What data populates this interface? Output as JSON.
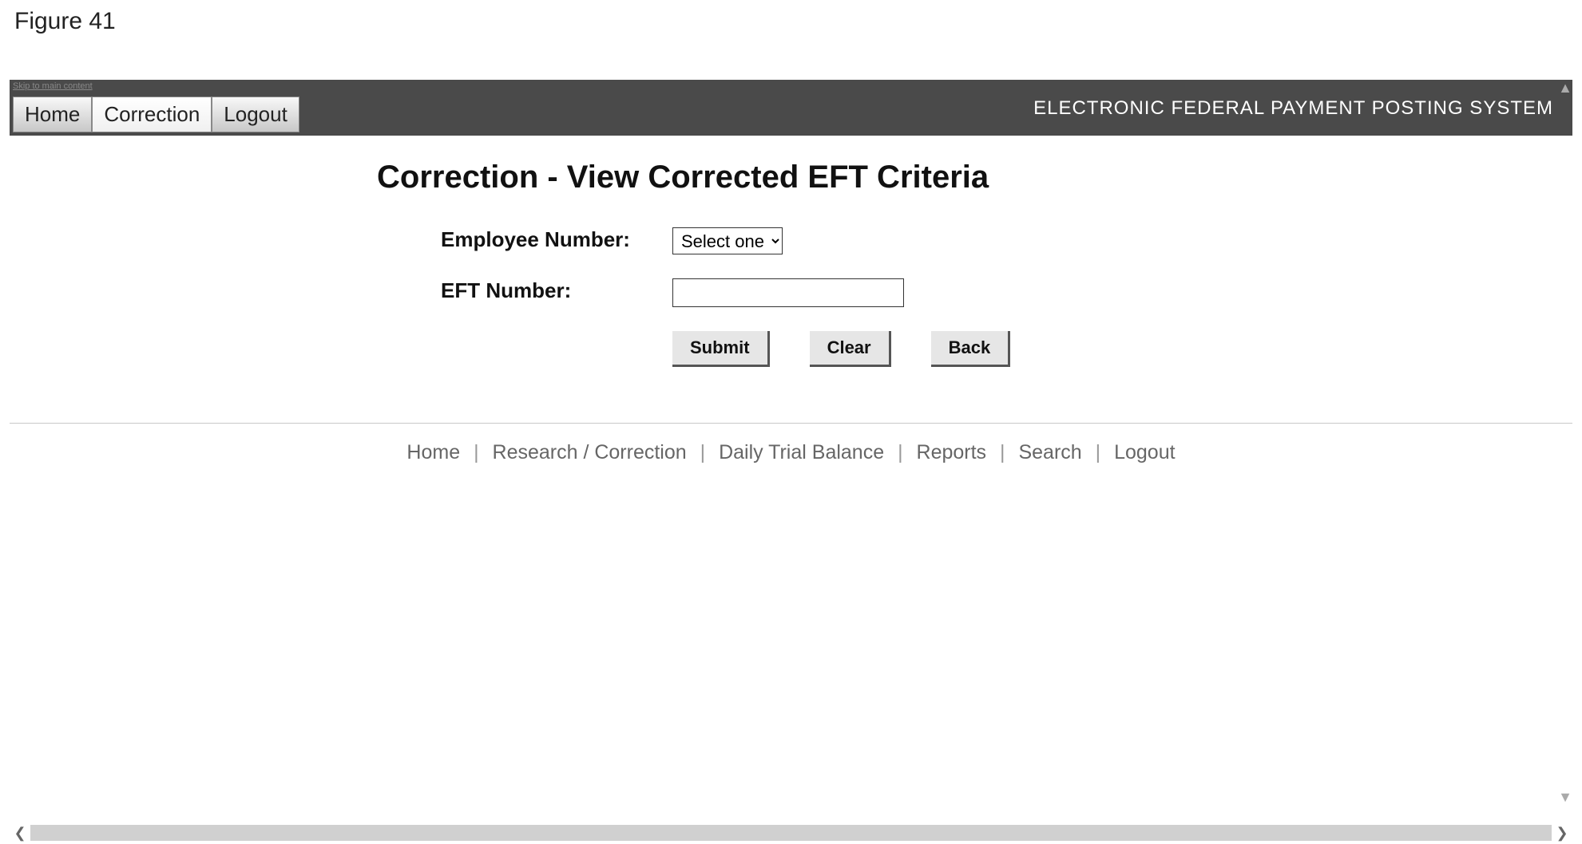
{
  "figure_label": "Figure 41",
  "header": {
    "skip_link": "Skip to main content",
    "system_title": "ELECTRONIC FEDERAL PAYMENT POSTING SYSTEM",
    "tabs": [
      {
        "label": "Home"
      },
      {
        "label": "Correction"
      },
      {
        "label": "Logout"
      }
    ]
  },
  "page": {
    "title": "Correction - View Corrected EFT Criteria"
  },
  "form": {
    "employee_label": "Employee Number:",
    "employee_selected": "Select one",
    "eft_label": "EFT Number:",
    "eft_value": ""
  },
  "buttons": {
    "submit": "Submit",
    "clear": "Clear",
    "back": "Back"
  },
  "footer": {
    "links": [
      "Home",
      "Research / Correction",
      "Daily Trial Balance",
      "Reports",
      "Search",
      "Logout"
    ]
  }
}
